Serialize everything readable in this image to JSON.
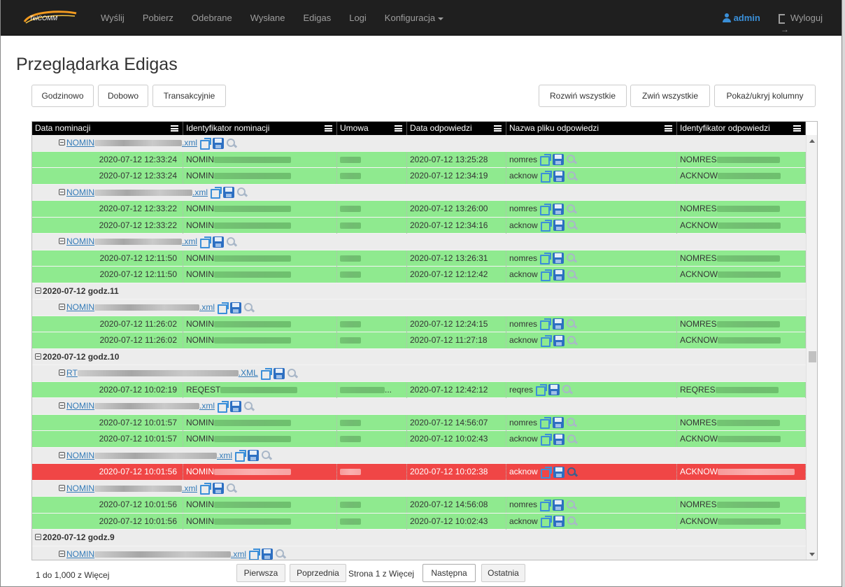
{
  "navbar": {
    "brand": "TelCOMM",
    "items": [
      "Wyślij",
      "Pobierz",
      "Odebrane",
      "Wysłane",
      "Edigas",
      "Logi",
      "Konfiguracja"
    ],
    "user": "admin",
    "logout": "Wyloguj"
  },
  "page": {
    "title": "Przeglądarka Edigas"
  },
  "toolbar": {
    "left": [
      "Godzinowo",
      "Dobowo",
      "Transakcyjnie"
    ],
    "right": [
      "Rozwiń wszystkie",
      "Zwiń wszystkie",
      "Pokaż/ukryj kolumny"
    ]
  },
  "grid": {
    "columns": [
      "Data nominacji",
      "Identyfikator nominacji",
      "Umowa",
      "Data odpowiedzi",
      "Nazwa pliku odpowiedzi",
      "Identyfikator odpowiedzi"
    ],
    "rows": [
      {
        "type": "file",
        "prefix": "NOMIN",
        "suffix": ".xml"
      },
      {
        "type": "data",
        "status": "green",
        "date": "2020-07-12 12:33:24",
        "id": "NOMIN",
        "resp_date": "2020-07-12 13:25:28",
        "file": "nomres",
        "resp_id": "NOMRES"
      },
      {
        "type": "data",
        "status": "green",
        "date": "2020-07-12 12:33:24",
        "id": "NOMIN",
        "resp_date": "2020-07-12 12:34:19",
        "file": "acknow",
        "resp_id": "ACKNOW"
      },
      {
        "type": "file",
        "prefix": "NOMIN",
        "suffix": ".xml"
      },
      {
        "type": "data",
        "status": "green",
        "date": "2020-07-12 12:33:22",
        "id": "NOMIN",
        "resp_date": "2020-07-12 13:26:00",
        "file": "nomres",
        "resp_id": "NOMRES"
      },
      {
        "type": "data",
        "status": "green",
        "date": "2020-07-12 12:33:22",
        "id": "NOMIN",
        "resp_date": "2020-07-12 12:34:16",
        "file": "acknow",
        "resp_id": "ACKNOW"
      },
      {
        "type": "file",
        "prefix": "NOMIN",
        "suffix": ".xml"
      },
      {
        "type": "data",
        "status": "green",
        "date": "2020-07-12 12:11:50",
        "id": "NOMIN",
        "resp_date": "2020-07-12 13:26:31",
        "file": "nomres",
        "resp_id": "NOMRES"
      },
      {
        "type": "data",
        "status": "green",
        "date": "2020-07-12 12:11:50",
        "id": "NOMIN",
        "resp_date": "2020-07-12 12:12:42",
        "file": "acknow",
        "resp_id": "ACKNOW"
      },
      {
        "type": "group",
        "label": "2020-07-12 godz.11"
      },
      {
        "type": "file",
        "prefix": "NOMIN",
        "suffix": ".xml"
      },
      {
        "type": "data",
        "status": "green",
        "date": "2020-07-12 11:26:02",
        "id": "NOMIN",
        "resp_date": "2020-07-12 12:24:15",
        "file": "nomres",
        "resp_id": "NOMRES"
      },
      {
        "type": "data",
        "status": "green",
        "date": "2020-07-12 11:26:02",
        "id": "NOMIN",
        "resp_date": "2020-07-12 11:27:18",
        "file": "acknow",
        "resp_id": "ACKNOW"
      },
      {
        "type": "group",
        "label": "2020-07-12 godz.10"
      },
      {
        "type": "file",
        "prefix": "RT",
        "suffix": ".XML"
      },
      {
        "type": "data",
        "status": "green",
        "date": "2020-07-12 10:02:19",
        "id": "REQEST",
        "contract_tail": "...",
        "resp_date": "2020-07-12 12:42:12",
        "file": "reqres",
        "resp_id": "REQRES"
      },
      {
        "type": "file",
        "prefix": "NOMIN",
        "suffix": ".xml"
      },
      {
        "type": "data",
        "status": "green",
        "date": "2020-07-12 10:01:57",
        "id": "NOMIN",
        "resp_date": "2020-07-12 14:56:07",
        "file": "nomres",
        "resp_id": "NOMRES"
      },
      {
        "type": "data",
        "status": "green",
        "date": "2020-07-12 10:01:57",
        "id": "NOMIN",
        "resp_date": "2020-07-12 10:02:43",
        "file": "acknow",
        "resp_id": "ACKNOW"
      },
      {
        "type": "file",
        "prefix": "NOMIN",
        "suffix": ".xml"
      },
      {
        "type": "data",
        "status": "red",
        "date": "2020-07-12 10:01:56",
        "id": "NOMIN",
        "resp_date": "2020-07-12 10:02:38",
        "file": "acknow",
        "resp_id": "ACKNOW"
      },
      {
        "type": "file",
        "prefix": "NOMIN",
        "suffix": ".xml"
      },
      {
        "type": "data",
        "status": "green",
        "date": "2020-07-12 10:01:56",
        "id": "NOMIN",
        "resp_date": "2020-07-12 14:56:08",
        "file": "nomres",
        "resp_id": "NOMRES"
      },
      {
        "type": "data",
        "status": "green",
        "date": "2020-07-12 10:01:56",
        "id": "NOMIN",
        "resp_date": "2020-07-12 10:02:43",
        "file": "acknow",
        "resp_id": "ACKNOW"
      },
      {
        "type": "group",
        "label": "2020-07-12 godz.9"
      },
      {
        "type": "file",
        "prefix": "NOMIN",
        "suffix": ".xml"
      }
    ]
  },
  "footer": {
    "count": "1 do 1,000 z Więcej",
    "first": "Pierwsza",
    "prev": "Poprzednia",
    "page": "Strona 1 z Więcej",
    "next": "Następna",
    "last": "Ostatnia"
  },
  "colors": {
    "ok": "#8fea8f",
    "error": "#f04646",
    "header": "#000000",
    "link": "#337ab7",
    "admin": "#3a8fd8"
  }
}
